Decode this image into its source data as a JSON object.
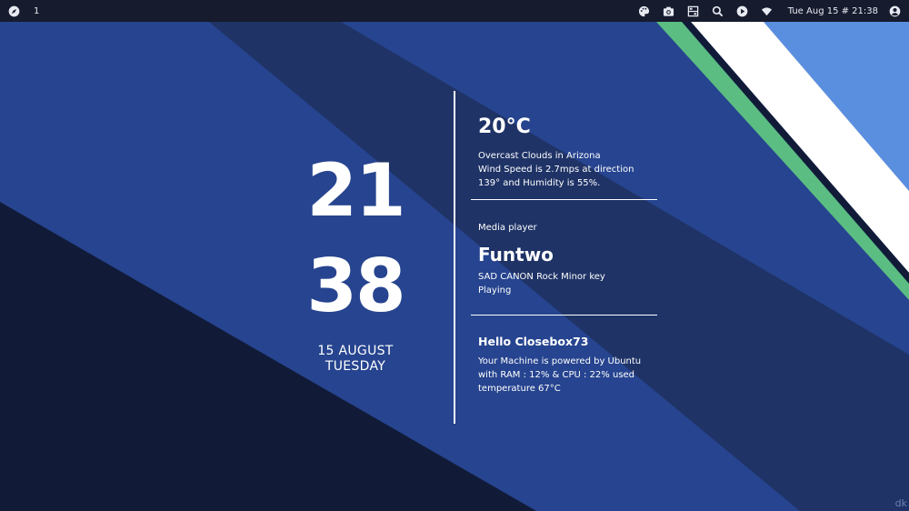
{
  "topbar": {
    "launcher_icon": "compass-icon",
    "workspace": "1",
    "tray_icons": [
      "palette-icon",
      "camera-icon",
      "layout-icon",
      "search-icon",
      "play-icon",
      "wifi-icon"
    ],
    "clock": "Tue Aug 15 # 21:38",
    "user_icon": "user-icon"
  },
  "clock_widget": {
    "hour": "21",
    "minute": "38",
    "date": "15 AUGUST",
    "weekday": "TUESDAY"
  },
  "weather": {
    "temperature": "20°C",
    "line1": "Overcast Clouds in Arizona",
    "line2": "Wind Speed is 2.7mps at direction",
    "line3": "139° and Humidity is 55%."
  },
  "media": {
    "label": "Media player",
    "title": "Funtwo",
    "line1": "SAD CANON Rock Minor key",
    "line2": "Playing"
  },
  "system": {
    "greeting": "Hello Closebox73",
    "line1": "Your Machine is powered by Ubuntu",
    "line2": "with RAM : 12% & CPU : 22% used",
    "line3": "temperature 67°C"
  },
  "corner_mark": "dk",
  "colors": {
    "base_blue": "#26448f",
    "dark_navy": "#111b38",
    "mid_stripe": "#1f3366",
    "light_blue": "#5a8fe0",
    "green_stripe": "#5bbd82",
    "white_stripe": "#ffffff",
    "topbar_bg": "#161b2d"
  }
}
